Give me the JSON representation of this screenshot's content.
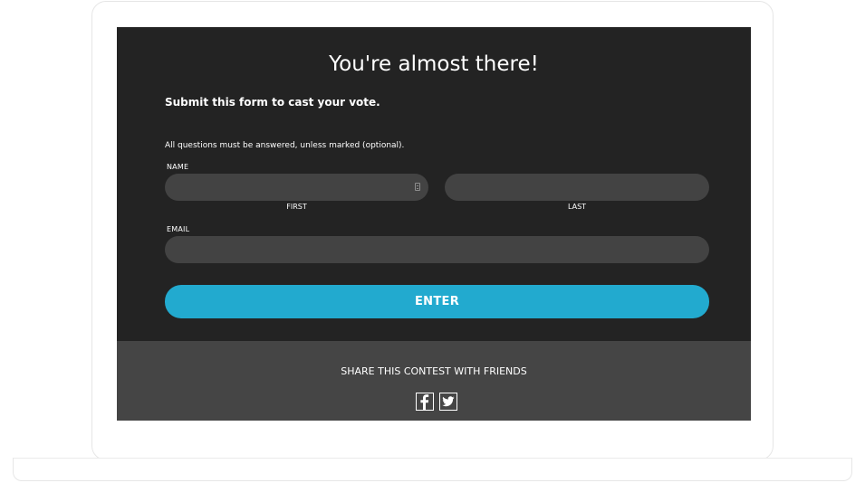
{
  "page": {
    "title": "You're almost there!",
    "subtitle": "Submit this form to cast your vote.",
    "instructions": "All questions must be answered, unless marked (optional)."
  },
  "form": {
    "name_label": "NAME",
    "first_value": "",
    "first_sublabel": "FIRST",
    "last_value": "",
    "last_sublabel": "LAST",
    "email_label": "EMAIL",
    "email_value": "",
    "submit_label": "ENTER"
  },
  "share": {
    "text": "SHARE THIS CONTEST WITH FRIENDS",
    "icons": [
      "facebook-icon",
      "twitter-icon"
    ]
  },
  "colors": {
    "form_background": "#232323",
    "share_background": "#454545",
    "input_background": "#434343",
    "accent": "#22aacf",
    "text": "#ffffff"
  }
}
